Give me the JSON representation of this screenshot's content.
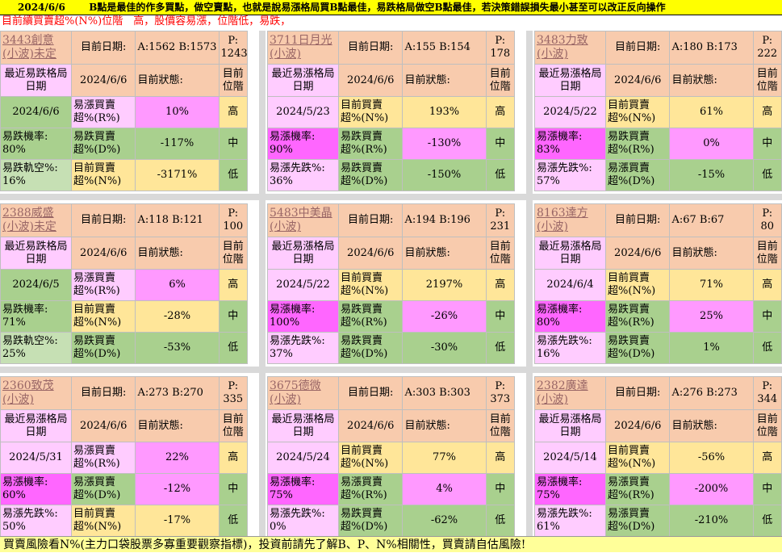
{
  "header": {
    "date": "2024/6/6",
    "text": "B點是最佳的作多買點，做空賣點，也就是說易漲格局買B點最佳，易跌格局做空B點最佳，若決策錯誤損失最小甚至可以改正反向操作",
    "subtitle": "目前續買賣超%(N%)位階　高，股價容易漲，位階低，易跌，"
  },
  "labels": {
    "current_date": "目前日期:",
    "current_status": "目前狀態:",
    "current_level": "目前位階",
    "recent_date_rise": "最近易漲格局日期",
    "recent_date_fall": "最近易跌格局日期",
    "N_label": "目前買賣超%(N%)",
    "R_rise": "易漲買賣超%(R%)",
    "R_fall": "易跌買賣超%(R%)",
    "D_rise": "易漲買賣超%(D%)",
    "D_fall": "易跌買賣超%(D%)"
  },
  "colors": {
    "peach": "#f8cbad",
    "light_pink": "#ffccff",
    "green": "#a9d08e",
    "yellow": "#ffe699",
    "magenta": "#ff66ff",
    "light_green": "#c6e0b4",
    "banner": "#ffff00",
    "footer": "#ffff99"
  },
  "panels": [
    {
      "name": "3443創意(小波)未定",
      "ab": "A:1562 B:1573",
      "p": "P: 1243",
      "date": "2024/6/6",
      "type": "fall",
      "recent": "2024/6/6",
      "r1_label": "易漲買賣超%(R%)",
      "r1_val": "10%",
      "r1_level": "高",
      "prob_label": "易跌機率: 80%",
      "r2_label": "易跌買賣超%(D%)",
      "r2_val": "-117%",
      "r2_level": "中",
      "track_label": "易跌軌空%: 16%",
      "r3_label": "目前買賣超%(N%)",
      "r3_val": "-3171%",
      "r3_level": "低"
    },
    {
      "name": "3711日月光(小波)",
      "ab": "A:155 B:154",
      "p": "P: 178",
      "date": "2024/6/6",
      "type": "rise",
      "recent": "2024/5/23",
      "r1_label": "目前買賣超%(N%)",
      "r1_val": "193%",
      "r1_level": "高",
      "prob_label": "易漲機率: 90%",
      "r2_label": "易跌買賣超%(R%)",
      "r2_val": "-130%",
      "r2_level": "中",
      "track_label": "易漲先跌%: 36%",
      "r3_label": "易跌買賣超%(D%)",
      "r3_val": "-150%",
      "r3_level": "低"
    },
    {
      "name": "3483力致(小波)",
      "ab": "A:180 B:173",
      "p": "P: 222",
      "date": "2024/6/6",
      "type": "rise",
      "recent": "2024/5/22",
      "r1_label": "目前買賣超%(N%)",
      "r1_val": "61%",
      "r1_level": "高",
      "prob_label": "易漲機率: 83%",
      "r2_label": "易跌買賣超%(R%)",
      "r2_val": "0%",
      "r2_level": "中",
      "track_label": "易漲先跌%: 57%",
      "r3_label": "易漲買賣超%(D%)",
      "r3_val": "-15%",
      "r3_level": "低"
    },
    {
      "name": "2388威盛(小波)未定",
      "ab": "A:118 B:121",
      "p": "P: 100",
      "date": "2024/6/6",
      "type": "fall",
      "recent": "2024/6/5",
      "r1_label": "易漲買賣超%(R%)",
      "r1_val": "6%",
      "r1_level": "高",
      "prob_label": "易跌機率: 71%",
      "r2_label": "目前買賣超%(N%)",
      "r2_val": "-28%",
      "r2_level": "中",
      "track_label": "易跌軌空%: 25%",
      "r3_label": "易跌買賣超%(D%)",
      "r3_val": "-53%",
      "r3_level": "低"
    },
    {
      "name": "5483中美晶(小波)",
      "ab": "A:194 B:196",
      "p": "P: 231",
      "date": "2024/6/6",
      "type": "rise",
      "recent": "2024/5/22",
      "r1_label": "目前買賣超%(N%)",
      "r1_val": "2197%",
      "r1_level": "高",
      "prob_label": "易漲機率: 100%",
      "r2_label": "易跌買賣超%(R%)",
      "r2_val": "-26%",
      "r2_level": "中",
      "track_label": "易漲先跌%: 37%",
      "r3_label": "易跌買賣超%(D%)",
      "r3_val": "-30%",
      "r3_level": "低"
    },
    {
      "name": "8163達方(小波)",
      "ab": "A:67 B:67",
      "p": "P: 80",
      "date": "2024/6/6",
      "type": "rise",
      "recent": "2024/6/4",
      "r1_label": "目前買賣超%(N%)",
      "r1_val": "71%",
      "r1_level": "高",
      "prob_label": "易漲機率: 80%",
      "r2_label": "易跌買賣超%(R%)",
      "r2_val": "25%",
      "r2_level": "中",
      "track_label": "易漲先跌%: 16%",
      "r3_label": "易跌買賣超%(D%)",
      "r3_val": "1%",
      "r3_level": "低"
    },
    {
      "name": "2360致茂(小波)",
      "ab": "A:273 B:270",
      "p": "P: 335",
      "date": "2024/6/6",
      "type": "rise",
      "recent": "2024/5/31",
      "r1_label": "易漲買賣超%(R%)",
      "r1_val": "22%",
      "r1_level": "高",
      "prob_label": "易漲機率: 60%",
      "r2_label": "易漲買賣超%(D%)",
      "r2_val": "-12%",
      "r2_level": "中",
      "track_label": "易漲先跌%: 50%",
      "r3_label": "目前買賣超%(N%)",
      "r3_val": "-17%",
      "r3_level": "低"
    },
    {
      "name": "3675德微(小波)",
      "ab": "A:303 B:303",
      "p": "P: 373",
      "date": "2024/6/6",
      "type": "rise",
      "recent": "2024/5/24",
      "r1_label": "目前買賣超%(N%)",
      "r1_val": "77%",
      "r1_level": "高",
      "prob_label": "易漲機率: 75%",
      "r2_label": "易漲買賣超%(R%)",
      "r2_val": "4%",
      "r2_level": "中",
      "track_label": "易漲先跌%: 0%",
      "r3_label": "易跌買賣超%(D%)",
      "r3_val": "-62%",
      "r3_level": "低"
    },
    {
      "name": "2382廣達(小波)",
      "ab": "A:276 B:273",
      "p": "P: 344",
      "date": "2024/6/6",
      "type": "rise",
      "recent": "2024/5/14",
      "r1_label": "目前買賣超%(N%)",
      "r1_val": "-56%",
      "r1_level": "高",
      "prob_label": "易漲機率: 75%",
      "r2_label": "易漲買賣超%(R%)",
      "r2_val": "-200%",
      "r2_level": "中",
      "track_label": "易漲先跌%: 61%",
      "r3_label": "易漲買賣超%(D%)",
      "r3_val": "-210%",
      "r3_level": "低"
    }
  ],
  "footer": "買賣風險看N%(主力口袋股票多寡重要觀察指標)，投資前請先了解B、P、N%相關性，買賣請自估風險!"
}
